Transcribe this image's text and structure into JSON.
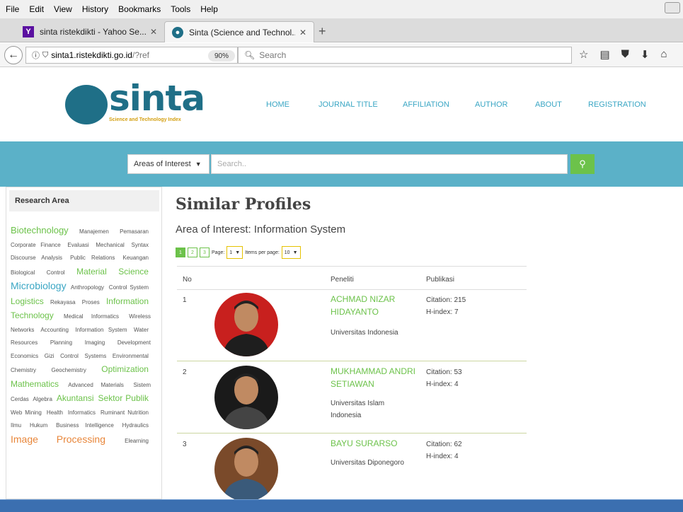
{
  "menubar": {
    "items": [
      "File",
      "Edit",
      "View",
      "History",
      "Bookmarks",
      "Tools",
      "Help"
    ]
  },
  "tabs": [
    {
      "title": "sinta ristekdikti - Yahoo Se...",
      "icon": "yahoo-icon",
      "active": false
    },
    {
      "title": "Sinta (Science and Technol...",
      "icon": "sinta-favicon",
      "active": true
    }
  ],
  "navbar": {
    "url_host": "sinta1.ristekdikti.go.id",
    "url_path": "/?ref",
    "zoom": "90%",
    "search_placeholder": "Search"
  },
  "site": {
    "logo_text": "sinta",
    "logo_tagline": "Science and Technology Index",
    "nav": [
      "HOME",
      "JOURNAL TITLE",
      "AFFILIATION",
      "AUTHOR",
      "ABOUT",
      "REGISTRATION"
    ],
    "area_select": "Areas of Interest",
    "search_placeholder": "Search..",
    "accent_color": "#6cc24a",
    "brand_color": "#1f6f87",
    "band_color": "#5bb1c8"
  },
  "sidebar": {
    "title": "Research Area",
    "tags": [
      {
        "t": "Biotechnology",
        "s": "lg"
      },
      {
        "t": "Manajemen",
        "s": ""
      },
      {
        "t": "Pemasaran",
        "s": ""
      },
      {
        "t": "Corporate Finance",
        "s": ""
      },
      {
        "t": "Evaluasi",
        "s": ""
      },
      {
        "t": "Mechanical",
        "s": ""
      },
      {
        "t": "Syntax",
        "s": ""
      },
      {
        "t": "Discourse Analysis",
        "s": ""
      },
      {
        "t": "Public Relations",
        "s": ""
      },
      {
        "t": "Keuangan",
        "s": ""
      },
      {
        "t": "Biological",
        "s": ""
      },
      {
        "t": "Control",
        "s": ""
      },
      {
        "t": "Material",
        "s": "md"
      },
      {
        "t": "Science",
        "s": "md"
      },
      {
        "t": "Microbiology",
        "s": "xl"
      },
      {
        "t": "Anthropology",
        "s": ""
      },
      {
        "t": "Control System",
        "s": ""
      },
      {
        "t": "Logistics",
        "s": "md"
      },
      {
        "t": "Rekayasa",
        "s": ""
      },
      {
        "t": "Proses",
        "s": ""
      },
      {
        "t": "Information",
        "s": "md"
      },
      {
        "t": "Technology",
        "s": "md"
      },
      {
        "t": "Medical Informatics",
        "s": ""
      },
      {
        "t": "Wireless Networks",
        "s": ""
      },
      {
        "t": "Accounting",
        "s": ""
      },
      {
        "t": "Information System",
        "s": ""
      },
      {
        "t": "Water",
        "s": ""
      },
      {
        "t": "Resources",
        "s": ""
      },
      {
        "t": "Planning",
        "s": ""
      },
      {
        "t": "Imaging",
        "s": ""
      },
      {
        "t": "Development Economics",
        "s": ""
      },
      {
        "t": "Gizi",
        "s": ""
      },
      {
        "t": "Control",
        "s": ""
      },
      {
        "t": "Systems",
        "s": ""
      },
      {
        "t": "Environmental",
        "s": ""
      },
      {
        "t": "Chemistry",
        "s": ""
      },
      {
        "t": "Geochemistry",
        "s": ""
      },
      {
        "t": "Optimization",
        "s": "md"
      },
      {
        "t": "Mathematics",
        "s": "md"
      },
      {
        "t": "Advanced Materials",
        "s": ""
      },
      {
        "t": "Sistem Cerdas",
        "s": ""
      },
      {
        "t": "Algebra",
        "s": ""
      },
      {
        "t": "Akuntansi",
        "s": "md"
      },
      {
        "t": "Sektor Publik",
        "s": "md"
      },
      {
        "t": "Web Mining",
        "s": ""
      },
      {
        "t": "Health",
        "s": ""
      },
      {
        "t": "Informatics",
        "s": ""
      },
      {
        "t": "Ruminant Nutrition",
        "s": ""
      },
      {
        "t": "Ilmu",
        "s": ""
      },
      {
        "t": "Hukum",
        "s": ""
      },
      {
        "t": "Business Intelligence",
        "s": ""
      },
      {
        "t": "Hydraulics",
        "s": ""
      },
      {
        "t": "Image Processing",
        "s": "or"
      },
      {
        "t": "Elearning",
        "s": ""
      }
    ]
  },
  "main": {
    "title": "Similar Profiles",
    "area_label": "Area of Interest: Information System",
    "pages": [
      "1",
      "2",
      "3"
    ],
    "page_label": "Page:",
    "page_value": "1",
    "items_label": "Items per page:",
    "items_value": "10",
    "columns": [
      "No",
      "Peneliti",
      "Publikasi"
    ],
    "rows": [
      {
        "no": "1",
        "name": "ACHMAD NIZAR HIDAYANTO",
        "affiliation": "Universitas Indonesia",
        "citation": "Citation: 215",
        "hindex": "H-index: 7",
        "bg": "#c8201e",
        "shirt": "#1e1e1e"
      },
      {
        "no": "2",
        "name": "MUKHAMMAD ANDRI SETIAWAN",
        "affiliation": "Universitas Islam Indonesia",
        "citation": "Citation: 53",
        "hindex": "H-index: 4",
        "bg": "#1a1a1a",
        "shirt": "#444444"
      },
      {
        "no": "3",
        "name": "BAYU SURARSO",
        "affiliation": "Universitas Diponegoro",
        "citation": "Citation: 62",
        "hindex": "H-index: 4",
        "bg": "#7a4a2a",
        "shirt": "#3a5a7a"
      }
    ]
  }
}
